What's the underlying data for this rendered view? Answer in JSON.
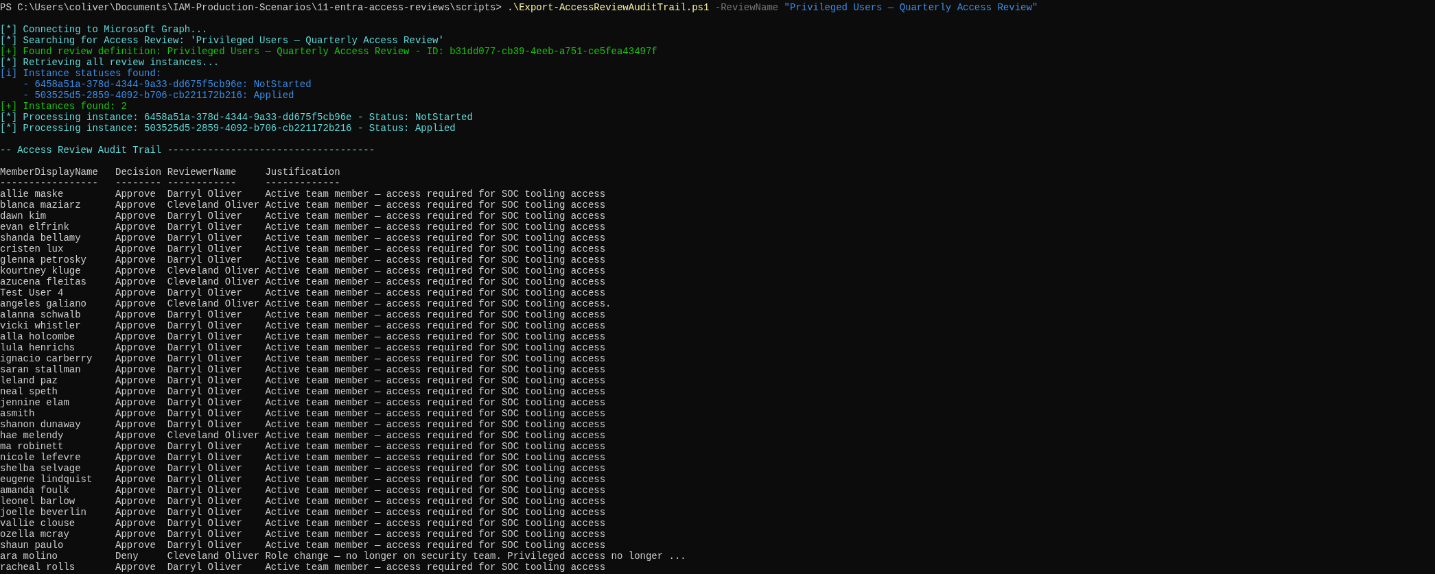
{
  "prompt": {
    "path": "PS C:\\Users\\coliver\\Documents\\IAM-Production-Scenarios\\11-entra-access-reviews\\scripts>",
    "command": ".\\Export-AccessReviewAuditTrail.ps1",
    "parameter": "-ReviewName",
    "argument": "\"Privileged Users — Quarterly Access Review\""
  },
  "messages": [
    {
      "kind": "status",
      "text": "[*] Connecting to Microsoft Graph..."
    },
    {
      "kind": "status",
      "text": "[*] Searching for Access Review: 'Privileged Users — Quarterly Access Review'"
    },
    {
      "kind": "success",
      "text": "[+] Found review definition: Privileged Users — Quarterly Access Review - ID: b31dd077-cb39-4eeb-a751-ce5fea43497f"
    },
    {
      "kind": "status",
      "text": "[*] Retrieving all review instances..."
    },
    {
      "kind": "info",
      "text": "[i] Instance statuses found:"
    },
    {
      "kind": "detail",
      "text": "- 6458a51a-378d-4344-9a33-dd675f5cb96e: NotStarted"
    },
    {
      "kind": "detail",
      "text": "- 503525d5-2859-4092-b706-cb221172b216: Applied"
    },
    {
      "kind": "success",
      "text": "[+] Instances found: 2"
    },
    {
      "kind": "status",
      "text": "[*] Processing instance: 6458a51a-378d-4344-9a33-dd675f5cb96e - Status: NotStarted"
    },
    {
      "kind": "status",
      "text": "[*] Processing instance: 503525d5-2859-4092-b706-cb221172b216 - Status: Applied"
    }
  ],
  "table": {
    "title": "-- Access Review Audit Trail ------------------------------------",
    "columns": [
      {
        "label": "MemberDisplayName",
        "underline": "-----------------"
      },
      {
        "label": "Decision",
        "underline": "--------"
      },
      {
        "label": "ReviewerName",
        "underline": "------------"
      },
      {
        "label": "Justification",
        "underline": "-------------"
      }
    ],
    "rows": [
      [
        "allie maske",
        "Approve",
        "Darryl Oliver",
        "Active team member — access required for SOC tooling access"
      ],
      [
        "blanca maziarz",
        "Approve",
        "Cleveland Oliver",
        "Active team member — access required for SOC tooling access"
      ],
      [
        "dawn kim",
        "Approve",
        "Darryl Oliver",
        "Active team member — access required for SOC tooling access"
      ],
      [
        "evan elfrink",
        "Approve",
        "Darryl Oliver",
        "Active team member — access required for SOC tooling access"
      ],
      [
        "shanda bellamy",
        "Approve",
        "Darryl Oliver",
        "Active team member — access required for SOC tooling access"
      ],
      [
        "cristen lux",
        "Approve",
        "Darryl Oliver",
        "Active team member — access required for SOC tooling access"
      ],
      [
        "glenna petrosky",
        "Approve",
        "Darryl Oliver",
        "Active team member — access required for SOC tooling access"
      ],
      [
        "kourtney kluge",
        "Approve",
        "Cleveland Oliver",
        "Active team member — access required for SOC tooling access"
      ],
      [
        "azucena fleitas",
        "Approve",
        "Cleveland Oliver",
        "Active team member — access required for SOC tooling access"
      ],
      [
        "Test User 4",
        "Approve",
        "Darryl Oliver",
        "Active team member — access required for SOC tooling access"
      ],
      [
        "angeles galiano",
        "Approve",
        "Cleveland Oliver",
        "Active team member — access required for SOC tooling access."
      ],
      [
        "alanna schwalb",
        "Approve",
        "Darryl Oliver",
        "Active team member — access required for SOC tooling access"
      ],
      [
        "vicki whistler",
        "Approve",
        "Darryl Oliver",
        "Active team member — access required for SOC tooling access"
      ],
      [
        "alla holcombe",
        "Approve",
        "Darryl Oliver",
        "Active team member — access required for SOC tooling access"
      ],
      [
        "lula henrichs",
        "Approve",
        "Darryl Oliver",
        "Active team member — access required for SOC tooling access"
      ],
      [
        "ignacio carberry",
        "Approve",
        "Darryl Oliver",
        "Active team member — access required for SOC tooling access"
      ],
      [
        "saran stallman",
        "Approve",
        "Darryl Oliver",
        "Active team member — access required for SOC tooling access"
      ],
      [
        "leland paz",
        "Approve",
        "Darryl Oliver",
        "Active team member — access required for SOC tooling access"
      ],
      [
        "neal speth",
        "Approve",
        "Darryl Oliver",
        "Active team member — access required for SOC tooling access"
      ],
      [
        "jennine elam",
        "Approve",
        "Darryl Oliver",
        "Active team member — access required for SOC tooling access"
      ],
      [
        "asmith",
        "Approve",
        "Darryl Oliver",
        "Active team member — access required for SOC tooling access"
      ],
      [
        "shanon dunaway",
        "Approve",
        "Darryl Oliver",
        "Active team member — access required for SOC tooling access"
      ],
      [
        "hae melendy",
        "Approve",
        "Cleveland Oliver",
        "Active team member — access required for SOC tooling access"
      ],
      [
        "ma robinett",
        "Approve",
        "Darryl Oliver",
        "Active team member — access required for SOC tooling access"
      ],
      [
        "nicole lefevre",
        "Approve",
        "Darryl Oliver",
        "Active team member — access required for SOC tooling access"
      ],
      [
        "shelba selvage",
        "Approve",
        "Darryl Oliver",
        "Active team member — access required for SOC tooling access"
      ],
      [
        "eugene lindquist",
        "Approve",
        "Darryl Oliver",
        "Active team member — access required for SOC tooling access"
      ],
      [
        "amanda foulk",
        "Approve",
        "Darryl Oliver",
        "Active team member — access required for SOC tooling access"
      ],
      [
        "leonel barlow",
        "Approve",
        "Darryl Oliver",
        "Active team member — access required for SOC tooling access"
      ],
      [
        "joelle beverlin",
        "Approve",
        "Darryl Oliver",
        "Active team member — access required for SOC tooling access"
      ],
      [
        "vallie clouse",
        "Approve",
        "Darryl Oliver",
        "Active team member — access required for SOC tooling access"
      ],
      [
        "ozella mcray",
        "Approve",
        "Darryl Oliver",
        "Active team member — access required for SOC tooling access"
      ],
      [
        "shaun paulo",
        "Approve",
        "Darryl Oliver",
        "Active team member — access required for SOC tooling access"
      ],
      [
        "ara molino",
        "Deny",
        "Cleveland Oliver",
        "Role change — no longer on security team. Privileged access no longer ..."
      ],
      [
        "racheal rolls",
        "Approve",
        "Darryl Oliver",
        "Active team member — access required for SOC tooling access"
      ]
    ]
  }
}
